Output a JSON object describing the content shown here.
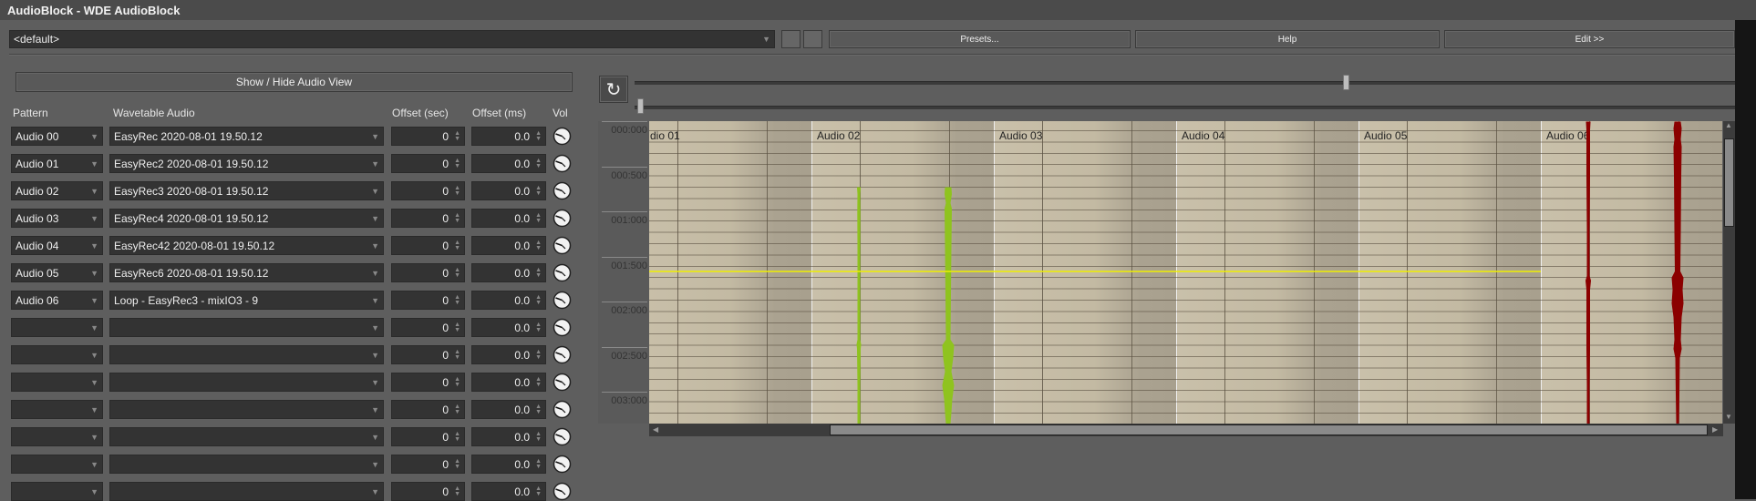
{
  "window": {
    "title": "AudioBlock - WDE AudioBlock"
  },
  "toolbar": {
    "preset_value": "<default>",
    "presets_label": "Presets...",
    "help_label": "Help",
    "edit_label": "Edit >>"
  },
  "panel": {
    "show_hide_label": "Show / Hide Audio View",
    "headers": {
      "pattern": "Pattern",
      "wavetable": "Wavetable Audio",
      "offset_sec": "Offset (sec)",
      "offset_ms": "Offset (ms)",
      "vol": "Vol"
    },
    "rows": [
      {
        "pattern": "Audio 00",
        "wavetable": "EasyRec 2020-08-01 19.50.12",
        "offset_sec": "0",
        "offset_ms": "0.0"
      },
      {
        "pattern": "Audio 01",
        "wavetable": "EasyRec2 2020-08-01 19.50.12",
        "offset_sec": "0",
        "offset_ms": "0.0"
      },
      {
        "pattern": "Audio 02",
        "wavetable": "EasyRec3 2020-08-01 19.50.12",
        "offset_sec": "0",
        "offset_ms": "0.0"
      },
      {
        "pattern": "Audio 03",
        "wavetable": "EasyRec4 2020-08-01 19.50.12",
        "offset_sec": "0",
        "offset_ms": "0.0"
      },
      {
        "pattern": "Audio 04",
        "wavetable": "EasyRec42 2020-08-01 19.50.12",
        "offset_sec": "0",
        "offset_ms": "0.0"
      },
      {
        "pattern": "Audio 05",
        "wavetable": "EasyRec6 2020-08-01 19.50.12",
        "offset_sec": "0",
        "offset_ms": "0.0"
      },
      {
        "pattern": "Audio 06",
        "wavetable": "Loop - EasyRec3 - mixIO3 - 9",
        "offset_sec": "0",
        "offset_ms": "0.0"
      },
      {
        "pattern": "",
        "wavetable": "",
        "offset_sec": "0",
        "offset_ms": "0.0"
      },
      {
        "pattern": "",
        "wavetable": "",
        "offset_sec": "0",
        "offset_ms": "0.0"
      },
      {
        "pattern": "",
        "wavetable": "",
        "offset_sec": "0",
        "offset_ms": "0.0"
      },
      {
        "pattern": "",
        "wavetable": "",
        "offset_sec": "0",
        "offset_ms": "0.0"
      },
      {
        "pattern": "",
        "wavetable": "",
        "offset_sec": "0",
        "offset_ms": "0.0"
      },
      {
        "pattern": "",
        "wavetable": "",
        "offset_sec": "0",
        "offset_ms": "0.0"
      },
      {
        "pattern": "",
        "wavetable": "",
        "offset_sec": "0",
        "offset_ms": "0.0"
      }
    ]
  },
  "timeline": {
    "zoom_slider_level": 0.65,
    "position_slider_level": 0.0,
    "columns": [
      "dio 01",
      "Audio 02",
      "Audio 03",
      "Audio 04",
      "Audio 05",
      "Audio 06"
    ],
    "time_labels": [
      "000:000",
      "000:500",
      "001:000",
      "001:500",
      "002:000",
      "002:500",
      "003:000"
    ],
    "playhead_color": "#f0f000",
    "wave_colors": {
      "audio02": "#8fc31f",
      "audio06": "#8b0000"
    }
  }
}
